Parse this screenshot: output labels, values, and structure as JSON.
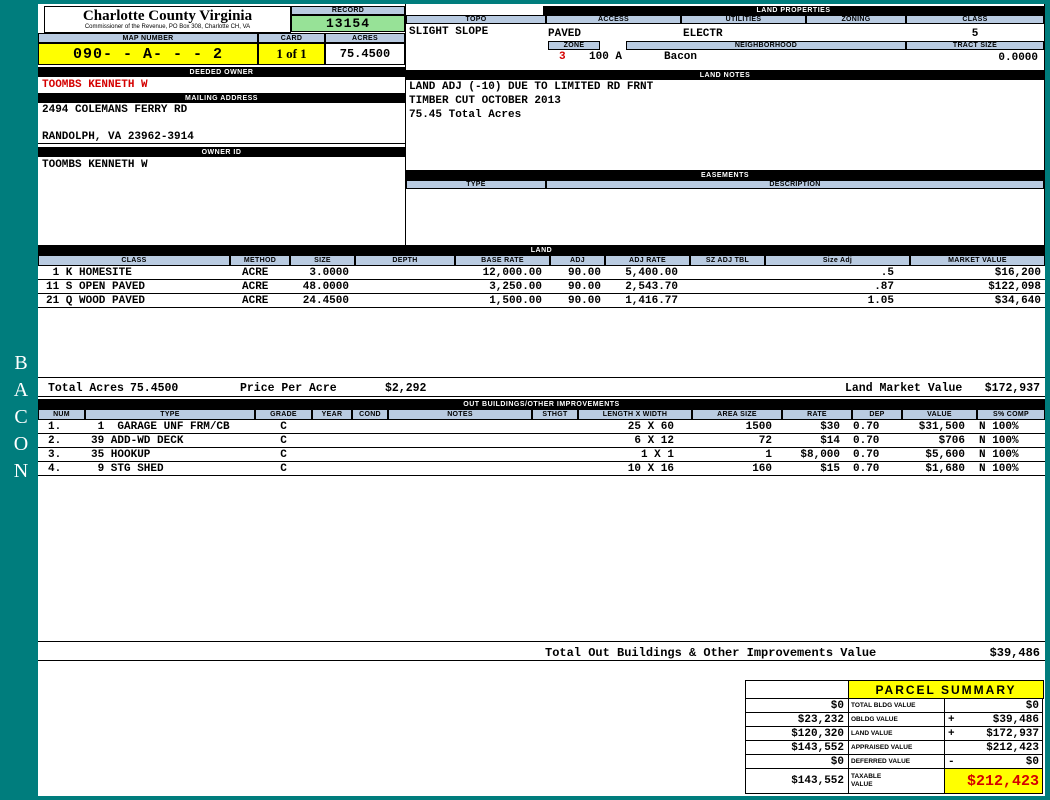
{
  "colors": {
    "background_teal": "#007d7d",
    "header_blue": "#b9cbe1",
    "record_green": "#97e297",
    "highlight_yellow": "#ffff00",
    "alert_red": "#d40000"
  },
  "sidebar": {
    "vertical_label": "BACON"
  },
  "county": {
    "title": "Charlotte County Virginia",
    "subtitle": "Commissioner of the Revenue, PO Box 308, Charlotte CH, VA"
  },
  "record": {
    "label": "RECORD",
    "value": "13154"
  },
  "map": {
    "map_number_label": "MAP NUMBER",
    "map_number": "090- - A- - - 2",
    "card_label": "CARD",
    "card": "1 of 1",
    "acres_label": "ACRES",
    "acres": "75.4500"
  },
  "owner": {
    "deeded_owner_label": "DEEDED OWNER",
    "deeded_owner": "TOOMBS KENNETH W",
    "mailing_address_label": "MAILING ADDRESS",
    "address_line1": "2494 COLEMANS FERRY RD",
    "address_line2": "RANDOLPH, VA 23962-3914",
    "owner_id_label": "OWNER ID",
    "owner_id": "TOOMBS KENNETH W"
  },
  "land_properties": {
    "label": "LAND PROPERTIES",
    "topo_label": "TOPO",
    "topo": "SLIGHT SLOPE",
    "access_label": "ACCESS",
    "access": "PAVED",
    "utilities_label": "UTILITIES",
    "utilities": "ELECTR",
    "zoning_label": "ZONING",
    "class_label": "CLASS",
    "class_value": "5",
    "zone_label": "ZONE",
    "zone": "3",
    "zone_code": "100 A",
    "neighborhood_label": "NEIGHBORHOOD",
    "neighborhood": "Bacon",
    "tract_size_label": "TRACT SIZE",
    "tract_size": "0.0000"
  },
  "land_notes": {
    "label": "LAND NOTES",
    "lines": [
      "LAND ADJ (-10) DUE TO LIMITED RD FRNT",
      "TIMBER CUT OCTOBER 2013",
      "75.45 Total Acres"
    ]
  },
  "easements": {
    "label": "EASEMENTS",
    "type_label": "TYPE",
    "description_label": "DESCRIPTION"
  },
  "land_table": {
    "label": "LAND",
    "headers": [
      "CLASS",
      "METHOD",
      "SIZE",
      "DEPTH",
      "BASE RATE",
      "ADJ",
      "ADJ RATE",
      "SZ ADJ TBL",
      "Size Adj",
      "MARKET VALUE"
    ],
    "rows": [
      {
        "class": " 1 K HOMESITE",
        "method": "ACRE",
        "size": "3.0000",
        "depth": "",
        "base_rate": "12,000.00",
        "adj": "90.00",
        "adj_rate": "5,400.00",
        "sz_adj_tbl": "",
        "size_adj": ".5",
        "market_value": "$16,200"
      },
      {
        "class": "11 S OPEN PAVED",
        "method": "ACRE",
        "size": "48.0000",
        "depth": "",
        "base_rate": "3,250.00",
        "adj": "90.00",
        "adj_rate": "2,543.70",
        "sz_adj_tbl": "",
        "size_adj": ".87",
        "market_value": "$122,098"
      },
      {
        "class": "21 Q WOOD PAVED",
        "method": "ACRE",
        "size": "24.4500",
        "depth": "",
        "base_rate": "1,500.00",
        "adj": "90.00",
        "adj_rate": "1,416.77",
        "sz_adj_tbl": "",
        "size_adj": "1.05",
        "market_value": "$34,640"
      }
    ],
    "total_acres_label": "Total Acres",
    "total_acres": "75.4500",
    "price_per_acre_label": "Price Per Acre",
    "price_per_acre": "$2,292",
    "land_market_value_label": "Land Market Value",
    "land_market_value": "$172,937"
  },
  "out_buildings": {
    "label": "OUT BUILDINGS/OTHER IMPROVEMENTS",
    "headers": [
      "NUM",
      "TYPE",
      "GRADE",
      "YEAR",
      "COND",
      "NOTES",
      "STHGT",
      "LENGTH X WIDTH",
      "AREA SIZE",
      "RATE",
      "DEP",
      "VALUE",
      "S% COMP"
    ],
    "rows": [
      {
        "num": "1.",
        "type": " 1  GARAGE UNF FRM/CB",
        "grade": "C",
        "year": "",
        "cond": "",
        "notes": "",
        "sthgt": "",
        "length_width": "25 X 60",
        "area_size": "1500",
        "rate": "$30",
        "dep": "0.70",
        "value": "$31,500",
        "s_comp": "N 100%"
      },
      {
        "num": "2.",
        "type": "39 ADD-WD DECK",
        "grade": "C",
        "year": "",
        "cond": "",
        "notes": "",
        "sthgt": "",
        "length_width": "6 X 12",
        "area_size": "72",
        "rate": "$14",
        "dep": "0.70",
        "value": "$706",
        "s_comp": "N 100%"
      },
      {
        "num": "3.",
        "type": "35 HOOKUP",
        "grade": "C",
        "year": "",
        "cond": "",
        "notes": "",
        "sthgt": "",
        "length_width": "1 X 1",
        "area_size": "1",
        "rate": "$8,000",
        "dep": "0.70",
        "value": "$5,600",
        "s_comp": "N 100%"
      },
      {
        "num": "4.",
        "type": " 9 STG SHED",
        "grade": "C",
        "year": "",
        "cond": "",
        "notes": "",
        "sthgt": "",
        "length_width": "10 X 16",
        "area_size": "160",
        "rate": "$15",
        "dep": "0.70",
        "value": "$1,680",
        "s_comp": "N 100%"
      }
    ],
    "total_label": "Total Out Buildings & Other Improvements Value",
    "total_value": "$39,486"
  },
  "parcel_summary": {
    "title": "PARCEL SUMMARY",
    "rows": [
      {
        "prior": "$0",
        "label": "TOTAL BLDG VALUE",
        "op": "",
        "value": "$0"
      },
      {
        "prior": "$23,232",
        "label": "OBLDG VALUE",
        "op": "+",
        "value": "$39,486"
      },
      {
        "prior": "$120,320",
        "label": "LAND VALUE",
        "op": "+",
        "value": "$172,937"
      },
      {
        "prior": "$143,552",
        "label": "APPRAISED VALUE",
        "op": "",
        "value": "$212,423"
      },
      {
        "prior": "$0",
        "label": "DEFERRED VALUE",
        "op": "-",
        "value": "$0"
      },
      {
        "prior": "$143,552",
        "label": "TAXABLE VALUE",
        "op": "",
        "value": "$212,423"
      }
    ]
  }
}
